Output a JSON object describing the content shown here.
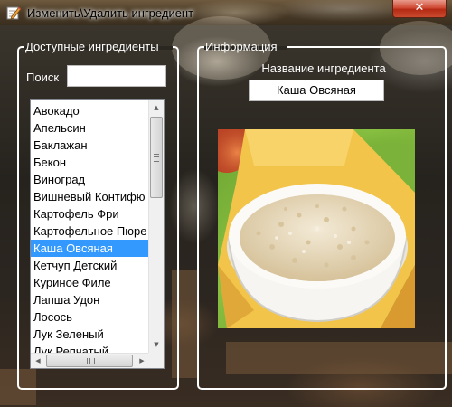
{
  "window": {
    "title": "Изменить\\Удалить ингредиент",
    "close_symbol": "✕",
    "icon": "pencil-icon"
  },
  "left_panel": {
    "group_title": "Доступные ингредиенты",
    "search_label": "Поиск",
    "search_value": "",
    "ingredients": [
      "Авокадо",
      "Апельсин",
      "Баклажан",
      "Бекон",
      "Виноград",
      "Вишневый Контифю",
      "Картофель Фри",
      "Картофельное Пюре",
      "Каша Овсяная",
      "Кетчуп Детский",
      "Куриное Филе",
      "Лапша Удон",
      "Лосось",
      "Лук Зеленый",
      "Лук Репчатый"
    ],
    "selected_index": 8
  },
  "right_panel": {
    "group_title": "Информация",
    "name_label": "Название ингредиента",
    "name_value": "Каша Овсяная",
    "image": "oatmeal-bowl-photo"
  },
  "colors": {
    "selection": "#3399ff",
    "group_border": "#ffffff",
    "close_button": "#c94a2e"
  }
}
